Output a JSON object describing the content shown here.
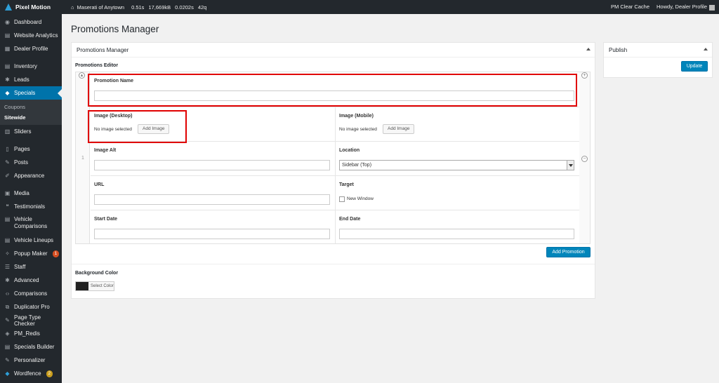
{
  "adminbar": {
    "brand": "Pixel Motion",
    "site_name": "Maserati of Anytown",
    "stats": [
      "0.51s",
      "17,669kB",
      "0.0202s",
      "42q"
    ],
    "clear_cache": "PM Clear Cache",
    "howdy": "Howdy, Dealer Profile"
  },
  "sidebar": {
    "items": [
      {
        "label": "Dashboard",
        "icon": "dashboard-icon"
      },
      {
        "label": "Website Analytics",
        "icon": "analytics-icon"
      },
      {
        "label": "Dealer Profile",
        "icon": "profile-icon"
      },
      {
        "label": "Inventory",
        "icon": "inventory-icon"
      },
      {
        "label": "Leads",
        "icon": "gear-icon"
      },
      {
        "label": "Specials",
        "icon": "tag-icon"
      },
      {
        "label": "Sliders",
        "icon": "slider-icon"
      },
      {
        "label": "Pages",
        "icon": "pages-icon"
      },
      {
        "label": "Posts",
        "icon": "pin-icon"
      },
      {
        "label": "Appearance",
        "icon": "brush-icon"
      },
      {
        "label": "Media",
        "icon": "media-icon"
      },
      {
        "label": "Testimonials",
        "icon": "quote-icon"
      },
      {
        "label": "Vehicle Comparisons",
        "icon": "document-icon"
      },
      {
        "label": "Vehicle Lineups",
        "icon": "document-icon"
      },
      {
        "label": "Popup Maker",
        "icon": "popup-icon",
        "badge": "1"
      },
      {
        "label": "Staff",
        "icon": "staff-icon"
      },
      {
        "label": "Advanced",
        "icon": "gear-icon"
      },
      {
        "label": "Comparisons",
        "icon": "code-icon"
      },
      {
        "label": "Duplicator Pro",
        "icon": "duplicator-icon"
      },
      {
        "label": "Page Type Checker",
        "icon": "pin-icon"
      },
      {
        "label": "PM_Redis",
        "icon": "redis-icon"
      },
      {
        "label": "Specials Builder",
        "icon": "builder-icon"
      },
      {
        "label": "Personalizer",
        "icon": "pin-icon"
      },
      {
        "label": "Wordfence",
        "icon": "wordfence-icon",
        "badge": "2"
      }
    ],
    "submenu": [
      "Coupons",
      "Sitewide"
    ]
  },
  "page": {
    "title": "Promotions Manager"
  },
  "main_box": {
    "title": "Promotions Manager",
    "editor_label": "Promotions Editor",
    "row_number": "1",
    "fields": {
      "promotion_name": "Promotion Name",
      "image_desktop": "Image (Desktop)",
      "image_mobile": "Image (Mobile)",
      "no_image": "No image selected",
      "add_image": "Add Image",
      "image_alt": "Image Alt",
      "location": "Location",
      "location_value": "Sidebar (Top)",
      "url": "URL",
      "target": "Target",
      "new_window": "New Window",
      "start_date": "Start Date",
      "end_date": "End Date"
    },
    "add_promotion": "Add Promotion",
    "bg_color_label": "Background Color",
    "select_color": "Select Color"
  },
  "publish_box": {
    "title": "Publish",
    "update": "Update"
  },
  "colors": {
    "admin_bar": "#23282d",
    "accent": "#0073aa",
    "highlight": "#e00000"
  }
}
